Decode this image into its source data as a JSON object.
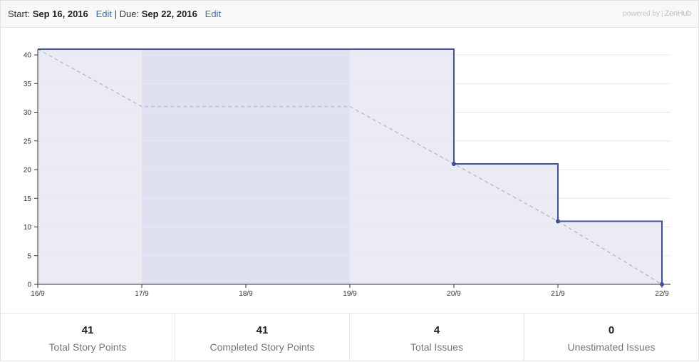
{
  "header": {
    "start_label": "Start:",
    "start_date": "Sep 16, 2016",
    "edit_start": "Edit",
    "separator": "|",
    "due_label": "Due:",
    "due_date": "Sep 22, 2016",
    "edit_due": "Edit",
    "powered_by": "powered by",
    "brand": "ZenHub"
  },
  "colors": {
    "actual_line": "#3f4f9a",
    "ideal_line": "#bdbdd0",
    "area_fill": "#ebebf6",
    "weekend_band": "#dfe0f0",
    "grid": "#e8e8ee"
  },
  "chart_data": {
    "type": "line",
    "x": [
      "16/9",
      "17/9",
      "18/9",
      "19/9",
      "20/9",
      "21/9",
      "22/9"
    ],
    "yticks": [
      0,
      5,
      10,
      15,
      20,
      25,
      30,
      35,
      40
    ],
    "ylim": [
      0,
      41
    ],
    "highlight_band": [
      "17/9",
      "19/9"
    ],
    "series": [
      {
        "values": [
          41,
          41,
          41,
          41,
          21,
          11,
          0
        ],
        "step": true
      },
      {
        "values": [
          41,
          31,
          31,
          31,
          21,
          11,
          0
        ],
        "dashed": true
      }
    ],
    "grid": true
  },
  "stats": [
    {
      "value": "41",
      "label": "Total Story Points"
    },
    {
      "value": "41",
      "label": "Completed Story Points"
    },
    {
      "value": "4",
      "label": "Total Issues"
    },
    {
      "value": "0",
      "label": "Unestimated Issues"
    }
  ]
}
